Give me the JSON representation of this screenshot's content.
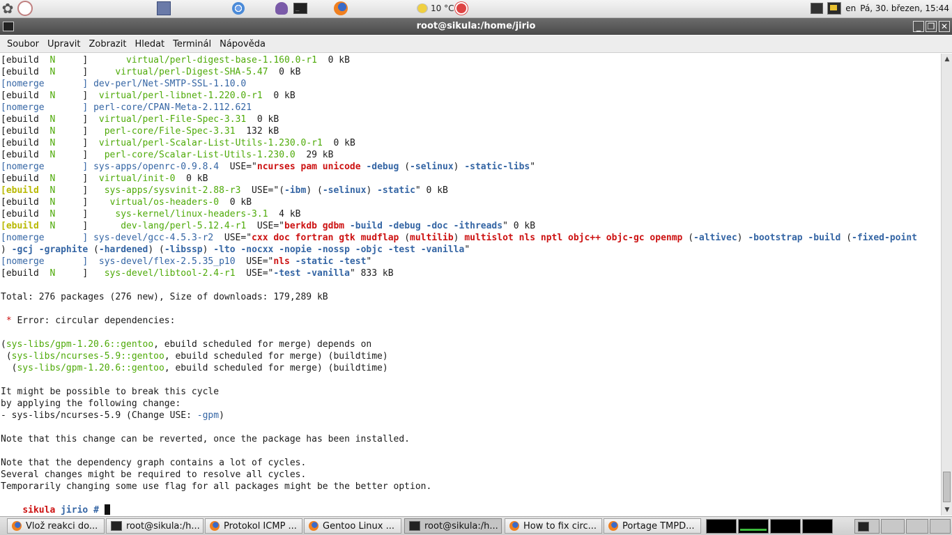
{
  "top_panel": {
    "icons": [
      "gnome-foot-icon",
      "clock-icon",
      "save-icon",
      "chromium-icon",
      "pidgin-icon",
      "terminal-icon",
      "firefox-icon"
    ],
    "weather": "10 °C",
    "keyboard_layout": "en",
    "datetime": "Pá, 30. březen, 15:44"
  },
  "window": {
    "title": "root@sikula:/home/jirio",
    "menu": [
      "Soubor",
      "Upravit",
      "Zobrazit",
      "Hledat",
      "Terminál",
      "Nápověda"
    ]
  },
  "terminal": {
    "lines": [
      [
        [
          "[ebuild  ",
          ""
        ],
        [
          "N",
          "g"
        ],
        [
          "     ]       ",
          ""
        ],
        [
          "virtual/perl-digest-base-1.160.0-r1",
          "g"
        ],
        [
          "  0 kB",
          ""
        ]
      ],
      [
        [
          "[ebuild  ",
          ""
        ],
        [
          "N",
          "g"
        ],
        [
          "     ]     ",
          ""
        ],
        [
          "virtual/perl-Digest-SHA-5.47",
          "g"
        ],
        [
          "  0 kB",
          ""
        ]
      ],
      [
        [
          "[nomerge       ] ",
          "b"
        ],
        [
          "dev-perl/Net-SMTP-SSL-1.10.0",
          "b"
        ]
      ],
      [
        [
          "[ebuild  ",
          ""
        ],
        [
          "N",
          "g"
        ],
        [
          "     ]  ",
          ""
        ],
        [
          "virtual/perl-libnet-1.220.0-r1",
          "g"
        ],
        [
          "  0 kB",
          ""
        ]
      ],
      [
        [
          "[nomerge       ] ",
          "b"
        ],
        [
          "perl-core/CPAN-Meta-2.112.621",
          "b"
        ]
      ],
      [
        [
          "[ebuild  ",
          ""
        ],
        [
          "N",
          "g"
        ],
        [
          "     ]  ",
          ""
        ],
        [
          "virtual/perl-File-Spec-3.31",
          "g"
        ],
        [
          "  0 kB",
          ""
        ]
      ],
      [
        [
          "[ebuild  ",
          ""
        ],
        [
          "N",
          "g"
        ],
        [
          "     ]   ",
          ""
        ],
        [
          "perl-core/File-Spec-3.31",
          "g"
        ],
        [
          "  132 kB",
          ""
        ]
      ],
      [
        [
          "[ebuild  ",
          ""
        ],
        [
          "N",
          "g"
        ],
        [
          "     ]  ",
          ""
        ],
        [
          "virtual/perl-Scalar-List-Utils-1.230.0-r1",
          "g"
        ],
        [
          "  0 kB",
          ""
        ]
      ],
      [
        [
          "[ebuild  ",
          ""
        ],
        [
          "N",
          "g"
        ],
        [
          "     ]   ",
          ""
        ],
        [
          "perl-core/Scalar-List-Utils-1.230.0",
          "g"
        ],
        [
          "  29 kB",
          ""
        ]
      ],
      [
        [
          "[nomerge       ] ",
          "b"
        ],
        [
          "sys-apps/openrc-0.9.8.4",
          "b"
        ],
        [
          "  USE=\"",
          ""
        ],
        [
          "ncurses pam unicode",
          "r"
        ],
        [
          " -debug",
          "bb"
        ],
        [
          " (",
          ""
        ],
        [
          "-selinux",
          "bb"
        ],
        [
          ") ",
          ""
        ],
        [
          "-static-libs",
          "bb"
        ],
        [
          "\"",
          ""
        ]
      ],
      [
        [
          "[ebuild  ",
          ""
        ],
        [
          "N",
          "g"
        ],
        [
          "     ]  ",
          ""
        ],
        [
          "virtual/init-0",
          "g"
        ],
        [
          "  0 kB",
          ""
        ]
      ],
      [
        [
          "[ebuild  ",
          "yy"
        ],
        [
          "N",
          "g"
        ],
        [
          "     ]   ",
          ""
        ],
        [
          "sys-apps/sysvinit-2.88-r3",
          "g"
        ],
        [
          "  USE=\"(",
          ""
        ],
        [
          "-ibm",
          "bb"
        ],
        [
          ") (",
          ""
        ],
        [
          "-selinux",
          "bb"
        ],
        [
          ") ",
          ""
        ],
        [
          "-static",
          "bb"
        ],
        [
          "\" 0 kB",
          ""
        ]
      ],
      [
        [
          "[ebuild  ",
          ""
        ],
        [
          "N",
          "g"
        ],
        [
          "     ]    ",
          ""
        ],
        [
          "virtual/os-headers-0",
          "g"
        ],
        [
          "  0 kB",
          ""
        ]
      ],
      [
        [
          "[ebuild  ",
          ""
        ],
        [
          "N",
          "g"
        ],
        [
          "     ]     ",
          ""
        ],
        [
          "sys-kernel/linux-headers-3.1",
          "g"
        ],
        [
          "  4 kB",
          ""
        ]
      ],
      [
        [
          "[ebuild  ",
          "yy"
        ],
        [
          "N",
          "g"
        ],
        [
          "     ]      ",
          ""
        ],
        [
          "dev-lang/perl-5.12.4-r1",
          "g"
        ],
        [
          "  USE=\"",
          ""
        ],
        [
          "berkdb gdbm",
          "r"
        ],
        [
          " -build -debug -doc -ithreads",
          "bb"
        ],
        [
          "\" 0 kB",
          ""
        ]
      ],
      [
        [
          "[nomerge       ] ",
          "b"
        ],
        [
          "sys-devel/gcc-4.5.3-r2",
          "b"
        ],
        [
          "  USE=\"",
          ""
        ],
        [
          "cxx doc fortran gtk mudflap",
          "r"
        ],
        [
          " (",
          ""
        ],
        [
          "multilib",
          "r"
        ],
        [
          ") ",
          ""
        ],
        [
          "multislot nls nptl objc++ objc-gc openmp",
          "r"
        ],
        [
          " (",
          ""
        ],
        [
          "-altivec",
          "bb"
        ],
        [
          ") ",
          ""
        ],
        [
          "-bootstrap -build",
          "bb"
        ],
        [
          " (",
          ""
        ],
        [
          "-fixed-point",
          "bb"
        ]
      ],
      [
        [
          ") ",
          ""
        ],
        [
          "-gcj -graphite",
          "bb"
        ],
        [
          " (",
          ""
        ],
        [
          "-hardened",
          "bb"
        ],
        [
          ") (",
          ""
        ],
        [
          "-libssp",
          "bb"
        ],
        [
          ") ",
          ""
        ],
        [
          "-lto -nocxx -nopie -nossp -objc -test -vanilla",
          "bb"
        ],
        [
          "\"",
          ""
        ]
      ],
      [
        [
          "[nomerge       ]  ",
          "b"
        ],
        [
          "sys-devel/flex-2.5.35_p10",
          "b"
        ],
        [
          "  USE=\"",
          ""
        ],
        [
          "nls",
          "r"
        ],
        [
          " -static -test",
          "bb"
        ],
        [
          "\"",
          ""
        ]
      ],
      [
        [
          "[ebuild  ",
          ""
        ],
        [
          "N",
          "g"
        ],
        [
          "     ]   ",
          ""
        ],
        [
          "sys-devel/libtool-2.4-r1",
          "g"
        ],
        [
          "  USE=\"",
          ""
        ],
        [
          "-test -vanilla",
          "bb"
        ],
        [
          "\" 833 kB",
          ""
        ]
      ],
      [
        [
          "",
          ""
        ]
      ],
      [
        [
          "Total: 276 packages (276 new), Size of downloads: 179,289 kB",
          ""
        ]
      ],
      [
        [
          "",
          ""
        ]
      ],
      [
        [
          " * ",
          "rr"
        ],
        [
          "Error: circular dependencies:",
          ""
        ]
      ],
      [
        [
          "",
          ""
        ]
      ],
      [
        [
          "(",
          ""
        ],
        [
          "sys-libs/gpm-1.20.6::gentoo",
          "g"
        ],
        [
          ", ebuild scheduled for merge) depends on",
          ""
        ]
      ],
      [
        [
          " (",
          ""
        ],
        [
          "sys-libs/ncurses-5.9::gentoo",
          "g"
        ],
        [
          ", ebuild scheduled for merge) (buildtime)",
          ""
        ]
      ],
      [
        [
          "  (",
          ""
        ],
        [
          "sys-libs/gpm-1.20.6::gentoo",
          "g"
        ],
        [
          ", ebuild scheduled for merge) (buildtime)",
          ""
        ]
      ],
      [
        [
          "",
          ""
        ]
      ],
      [
        [
          "It might be possible to break this cycle",
          ""
        ]
      ],
      [
        [
          "by applying the following change:",
          ""
        ]
      ],
      [
        [
          "- sys-libs/ncurses-5.9 (Change USE: ",
          ""
        ],
        [
          "-gpm",
          "b"
        ],
        [
          ")",
          ""
        ]
      ],
      [
        [
          "",
          ""
        ]
      ],
      [
        [
          "Note that this change can be reverted, once the package has been installed.",
          ""
        ]
      ],
      [
        [
          "",
          ""
        ]
      ],
      [
        [
          "Note that the dependency graph contains a lot of cycles.",
          ""
        ]
      ],
      [
        [
          "Several changes might be required to resolve all cycles.",
          ""
        ]
      ],
      [
        [
          "Temporarily changing some use flag for all packages might be the better option.",
          ""
        ]
      ]
    ],
    "prompt_host": "sikula",
    "prompt_dir": " jirio #"
  },
  "taskbar": {
    "tasks": [
      {
        "label": "Vlož reakci do...",
        "icon": "firefox-icon",
        "active": false
      },
      {
        "label": "root@sikula:/h...",
        "icon": "terminal-icon",
        "active": false
      },
      {
        "label": "Protokol ICMP ...",
        "icon": "firefox-icon",
        "active": false
      },
      {
        "label": "Gentoo Linux ...",
        "icon": "firefox-icon",
        "active": false
      },
      {
        "label": "root@sikula:/h...",
        "icon": "terminal-icon",
        "active": true
      },
      {
        "label": "How to fix circ...",
        "icon": "firefox-icon",
        "active": false
      },
      {
        "label": "Portage TMPD...",
        "icon": "firefox-icon",
        "active": false
      }
    ]
  }
}
